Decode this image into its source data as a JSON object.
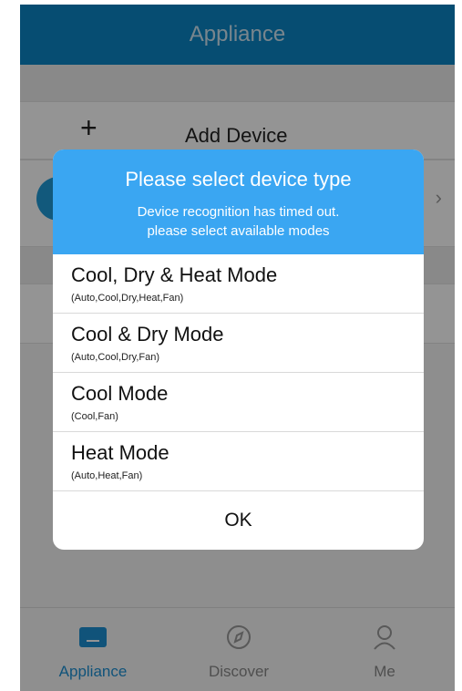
{
  "header": {
    "title": "Appliance"
  },
  "list": {
    "add_label": "Add Device",
    "add_icon": "plus-icon",
    "chevron": "›"
  },
  "tabs": [
    {
      "label": "Appliance",
      "icon": "appliance-icon",
      "active": true
    },
    {
      "label": "Discover",
      "icon": "compass-icon",
      "active": false
    },
    {
      "label": "Me",
      "icon": "user-icon",
      "active": false
    }
  ],
  "dialog": {
    "title": "Please select device type",
    "message_line1": "Device recognition has timed out.",
    "message_line2": "please select available modes",
    "modes": [
      {
        "title": "Cool, Dry & Heat Mode",
        "subtitle": "(Auto,Cool,Dry,Heat,Fan)"
      },
      {
        "title": "Cool & Dry Mode",
        "subtitle": "(Auto,Cool,Dry,Fan)"
      },
      {
        "title": "Cool Mode",
        "subtitle": "(Cool,Fan)"
      },
      {
        "title": "Heat Mode",
        "subtitle": "(Auto,Heat,Fan)"
      }
    ],
    "ok_label": "OK"
  },
  "colors": {
    "header_bg": "#0c86c4",
    "dialog_header_bg": "#3aa6f2",
    "active_tab": "#1d8fd3"
  }
}
